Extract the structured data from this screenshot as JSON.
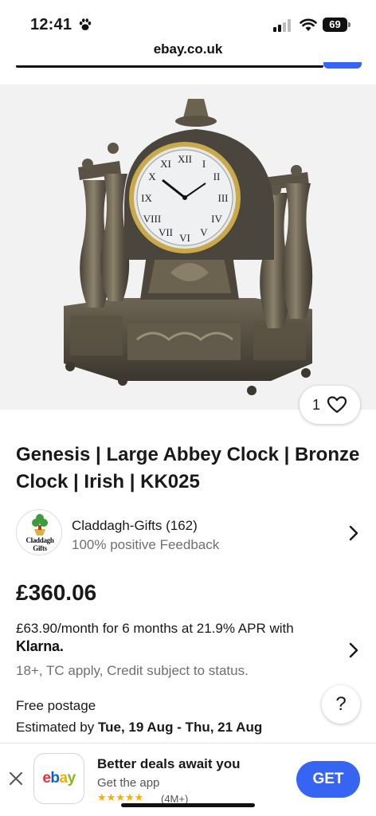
{
  "status_bar": {
    "time": "12:41",
    "battery": "69"
  },
  "browser": {
    "url": "ebay.co.uk"
  },
  "listing": {
    "watch_count": "1",
    "title": "Genesis | Large Abbey Clock | Bronze Clock | Irish | KK025",
    "seller": {
      "logo_text": "Claddagh Gifts",
      "name": "Claddagh-Gifts (162)",
      "feedback": "100% positive Feedback"
    },
    "price": "£360.06",
    "finance": {
      "text": "£63.90/month for 6 months at 21.9% APR with",
      "provider": "Klarna.",
      "note": "18+, TC apply, Credit subject to status."
    },
    "shipping": {
      "postage": "Free postage",
      "estimated_prefix": "Estimated by ",
      "estimated_dates": "Tue, 19 Aug - Thu, 21 Aug"
    },
    "help_label": "?"
  },
  "app_banner": {
    "icon_text": [
      "e",
      "b",
      "a",
      "y"
    ],
    "icon_colors": [
      "#e53238",
      "#0064d2",
      "#f5af02",
      "#86b817"
    ],
    "title": "Better deals await you",
    "subtitle": "Get the app",
    "stars": "★★★★★",
    "rating_count": "(4M+)",
    "get_label": "GET"
  },
  "colors": {
    "accent": "#3665f3",
    "star": "#f5af02",
    "muted": "#707070"
  },
  "icons": [
    "paw-icon",
    "signal-icon",
    "wifi-icon",
    "battery-icon",
    "heart-icon",
    "chevron-right-icon",
    "close-icon"
  ]
}
